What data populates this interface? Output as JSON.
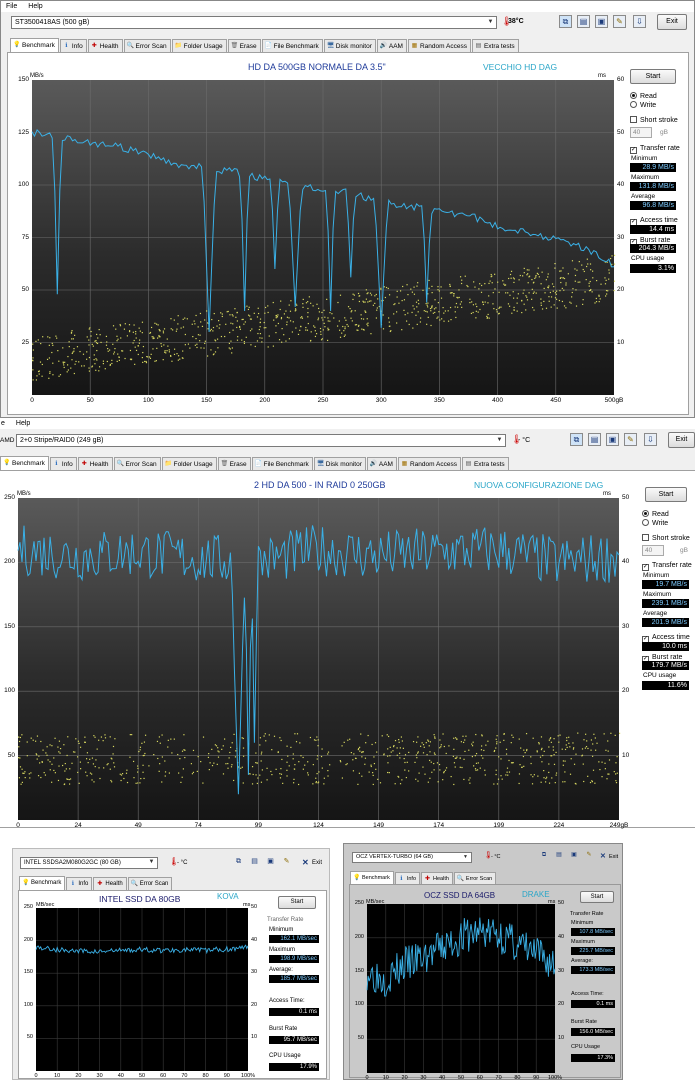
{
  "w1": {
    "menu": {
      "file": "File",
      "help": "Help"
    },
    "drive": "ST3500418AS (500 gB)",
    "temp": "38°C",
    "exit": "Exit",
    "tabs": [
      "Benchmark",
      "Info",
      "Health",
      "Error Scan",
      "Folder Usage",
      "Erase",
      "File Benchmark",
      "Disk monitor",
      "AAM",
      "Random Access",
      "Extra tests"
    ],
    "title": "HD DA 500GB NORMALE DA 3.5\"",
    "subtitle": "VECCHIO HD DAG",
    "yunit": "MB/s",
    "yunit_r": "ms",
    "start": "Start",
    "read": "Read",
    "write": "Write",
    "short_stroke": "Short stroke",
    "stroke_val": "40",
    "stroke_unit": "gB",
    "transfer_rate": "Transfer rate",
    "minimum": "Minimum",
    "min_val": "28.9 MB/s",
    "maximum": "Maximum",
    "max_val": "131.8 MB/s",
    "average": "Average",
    "avg_val": "96.8 MB/s",
    "access_time": "Access time",
    "access_val": "14.4 ms",
    "burst_rate": "Burst rate",
    "burst_val": "204.3 MB/s",
    "cpu_usage": "CPU usage",
    "cpu_val": "3.1%"
  },
  "w2": {
    "menu": {
      "file": "e",
      "help": "Help"
    },
    "drive_prefix": "AMD",
    "drive": "2+0 Stripe/RAID0 (249 gB)",
    "temp": "- °C",
    "exit": "Exit",
    "tabs": [
      "Benchmark",
      "Info",
      "Health",
      "Error Scan",
      "Folder Usage",
      "Erase",
      "File Benchmark",
      "Disk monitor",
      "AAM",
      "Random Access",
      "Extra tests"
    ],
    "title": "2 HD DA 500 - IN RAID 0   250GB",
    "subtitle": "NUOVA CONFIGURAZIONE DAG",
    "yunit": "MB/s",
    "yunit_r": "ms",
    "start": "Start",
    "read": "Read",
    "write": "Write",
    "short_stroke": "Short stroke",
    "stroke_val": "40",
    "stroke_unit": "gB",
    "transfer_rate": "Transfer rate",
    "minimum": "Minimum",
    "min_val": "19.7 MB/s",
    "maximum": "Maximum",
    "max_val": "239.1 MB/s",
    "average": "Average",
    "avg_val": "201.9 MB/s",
    "access_time": "Access time",
    "access_val": "10.0 ms",
    "burst_rate": "Burst rate",
    "burst_val": "179.7 MB/s",
    "cpu_usage": "CPU usage",
    "cpu_val": "11.6%"
  },
  "w3": {
    "drive": "INTEL SSDSA2M080G2GC (80 GB)",
    "temp": "- °C",
    "exit": "Exit",
    "tabs": [
      "Benchmark",
      "Info",
      "Health",
      "Error Scan"
    ],
    "title": "INTEL SSD DA 80GB",
    "subtitle": "KOVA",
    "yunit": "MB/sec",
    "yunit_r": "ms",
    "start": "Start",
    "transfer_rate": "Transfer Rate",
    "minimum": "Minimum",
    "min_val": "162.1 MB/sec",
    "maximum": "Maximum",
    "max_val": "198.9 MB/sec",
    "average": "Average:",
    "avg_val": "185.7 MB/sec",
    "access_time": "Access Time:",
    "access_val": "0.1 ms",
    "burst_rate": "Burst Rate",
    "burst_val": "95.7 MB/sec",
    "cpu_usage": "CPU Usage",
    "cpu_val": "17.9%"
  },
  "w4": {
    "drive": "OCZ VERTEX-TURBO (64 GB)",
    "temp": "- °C",
    "exit": "Exit",
    "tabs": [
      "Benchmark",
      "Info",
      "Health",
      "Error Scan"
    ],
    "title": "OCZ SSD DA 64GB",
    "subtitle": "DRAKE",
    "yunit": "MB/sec",
    "yunit_r": "ms",
    "start": "Start",
    "transfer_rate": "Transfer Rate",
    "minimum": "Minimum",
    "min_val": "107.8 MB/sec",
    "maximum": "Maximum",
    "max_val": "225.7 MB/sec",
    "average": "Average:",
    "avg_val": "173.3 MB/sec",
    "access_time": "Access Time:",
    "access_val": "0.1 ms",
    "burst_rate": "Burst Rate",
    "burst_val": "156.0 MB/sec",
    "cpu_usage": "CPU Usage",
    "cpu_val": "17.3%"
  },
  "axes": {
    "w1_y": [
      "150",
      "125",
      "100",
      "75",
      "50",
      "25"
    ],
    "w1_yr": [
      "60",
      "50",
      "40",
      "30",
      "20",
      "10"
    ],
    "w1_x": [
      "0",
      "50",
      "100",
      "150",
      "200",
      "250",
      "300",
      "350",
      "400",
      "450",
      "500gB"
    ],
    "w2_y": [
      "250",
      "200",
      "150",
      "100",
      "50"
    ],
    "w2_yr": [
      "50",
      "40",
      "30",
      "20",
      "10"
    ],
    "w2_x": [
      "0",
      "24",
      "49",
      "74",
      "99",
      "124",
      "149",
      "174",
      "199",
      "224",
      "249gB"
    ],
    "w3_y": [
      "250",
      "200",
      "150",
      "100",
      "50"
    ],
    "w3_yr": [
      "50",
      "40",
      "30",
      "20",
      "10"
    ],
    "w3_x": [
      "0",
      "10",
      "20",
      "30",
      "40",
      "50",
      "60",
      "70",
      "80",
      "90",
      "100%"
    ],
    "w4_y": [
      "250",
      "200",
      "150",
      "100",
      "50"
    ],
    "w4_yr": [
      "50",
      "40",
      "30",
      "20",
      "10"
    ],
    "w4_x": [
      "0",
      "10",
      "20",
      "30",
      "40",
      "50",
      "60",
      "70",
      "80",
      "90",
      "100%"
    ]
  },
  "colors": {
    "line": "#3ab0e6",
    "dots": "#d8d860",
    "title": "#1e3a9a",
    "subtitle": "#2aa6c8"
  },
  "chart_data": [
    {
      "type": "line",
      "title": "HD DA 500GB NORMALE DA 3.5\"",
      "ylabel": "MB/s",
      "ylim": [
        0,
        150
      ],
      "xlim": [
        0,
        500
      ],
      "x": [
        0,
        25,
        50,
        75,
        100,
        125,
        150,
        175,
        200,
        225,
        250,
        275,
        300,
        325,
        350,
        375,
        400,
        425,
        450,
        475,
        500
      ],
      "series": [
        {
          "values": [
            125,
            123,
            120,
            118,
            114,
            110,
            108,
            106,
            103,
            100,
            98,
            96,
            92,
            90,
            87,
            86,
            80,
            78,
            74,
            70,
            62
          ]
        }
      ]
    },
    {
      "type": "line",
      "title": "2 HD DA 500 - IN RAID 0   250GB",
      "ylabel": "MB/s",
      "ylim": [
        0,
        250
      ],
      "xlim": [
        0,
        249
      ],
      "x": [
        0,
        24,
        49,
        74,
        99,
        124,
        149,
        174,
        199,
        224,
        249
      ],
      "series": [
        {
          "values": [
            210,
            205,
            208,
            203,
            200,
            210,
            205,
            208,
            210,
            200,
            205
          ]
        }
      ]
    },
    {
      "type": "line",
      "title": "INTEL SSD DA 80GB",
      "ylabel": "MB/sec",
      "ylim": [
        0,
        250
      ],
      "xlim": [
        0,
        100
      ],
      "x": [
        0,
        10,
        20,
        30,
        40,
        50,
        60,
        70,
        80,
        90,
        100
      ],
      "series": [
        {
          "values": [
            190,
            186,
            184,
            183,
            185,
            186,
            185,
            186,
            185,
            187,
            190
          ]
        }
      ]
    },
    {
      "type": "line",
      "title": "OCZ SSD DA 64GB",
      "ylabel": "MB/sec",
      "ylim": [
        0,
        250
      ],
      "xlim": [
        0,
        100
      ],
      "x": [
        0,
        10,
        20,
        30,
        40,
        50,
        60,
        70,
        80,
        90,
        100
      ],
      "series": [
        {
          "values": [
            150,
            140,
            160,
            170,
            185,
            200,
            210,
            205,
            190,
            175,
            160
          ]
        }
      ]
    }
  ]
}
